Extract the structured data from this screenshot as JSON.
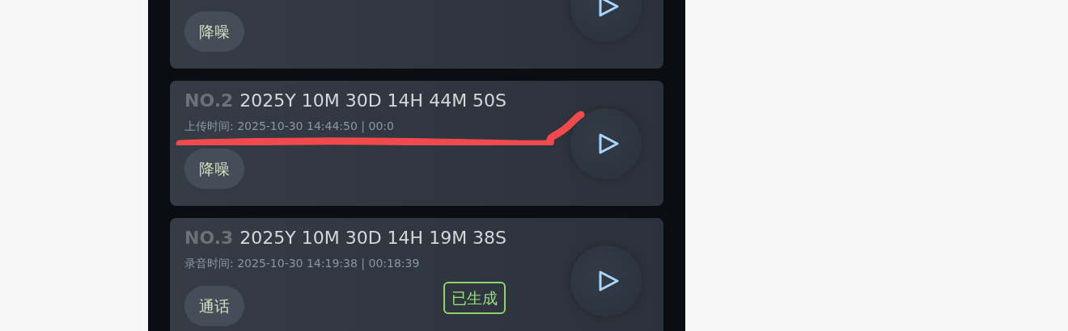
{
  "recordings": [
    {
      "tag": "降噪"
    },
    {
      "number": "NO.2",
      "title": "2025Y 10M 30D 14H 44M 50S",
      "meta": "上传时间: 2025-10-30 14:44:50 | 00:0",
      "tag": "降噪",
      "annotated": true
    },
    {
      "number": "NO.3",
      "title": "2025Y 10M 30D 14H 19M 38S",
      "meta": "录音时间: 2025-10-30 14:19:38 | 00:18:39",
      "tag": "通话",
      "status": "已生成",
      "annotated": false
    }
  ]
}
